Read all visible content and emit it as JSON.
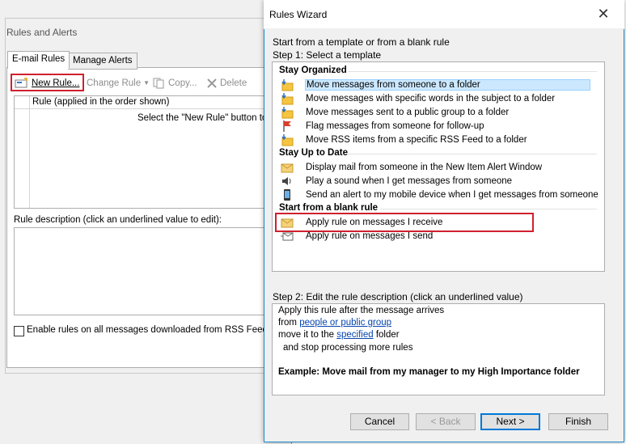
{
  "rules_alerts": {
    "title": "Rules and Alerts",
    "tabs": [
      "E-mail Rules",
      "Manage Alerts"
    ],
    "toolbar": {
      "new_rule": "New Rule...",
      "change_rule": "Change Rule",
      "copy": "Copy...",
      "delete": "Delete"
    },
    "list_header": "Rule (applied in the order shown)",
    "empty_text": "Select the \"New Rule\" button to",
    "desc_label": "Rule description (click an underlined value to edit):",
    "rss_checkbox": "Enable rules on all messages downloaded from RSS Feed"
  },
  "wizard": {
    "title": "Rules Wizard",
    "close_glyph": "✕",
    "intro": "Start from a template or from a blank rule",
    "step1": "Step 1: Select a template",
    "groups": {
      "organized": "Stay Organized",
      "uptodate": "Stay Up to Date",
      "blank": "Start from a blank rule"
    },
    "items": [
      "Move messages from someone to a folder",
      "Move messages with specific words in the subject to a folder",
      "Move messages sent to a public group to a folder",
      "Flag messages from someone for follow-up",
      "Move RSS items from a specific RSS Feed to a folder",
      "Display mail from someone in the New Item Alert Window",
      "Play a sound when I get messages from someone",
      "Send an alert to my mobile device when I get messages from someone",
      "Apply rule on messages I receive",
      "Apply rule on messages I send"
    ],
    "step2": "Step 2: Edit the rule description (click an underlined value)",
    "desc": {
      "line1": "Apply this rule after the message arrives",
      "line2_pre": "from ",
      "line2_link": "people or public group",
      "line3_pre": "move it to the ",
      "line3_link": "specified",
      "line3_post": " folder",
      "line4": "and stop processing more rules",
      "example": "Example: Move mail from my manager to my High Importance folder"
    },
    "buttons": {
      "cancel": "Cancel",
      "back": "< Back",
      "next": "Next >",
      "finish": "Finish"
    }
  }
}
